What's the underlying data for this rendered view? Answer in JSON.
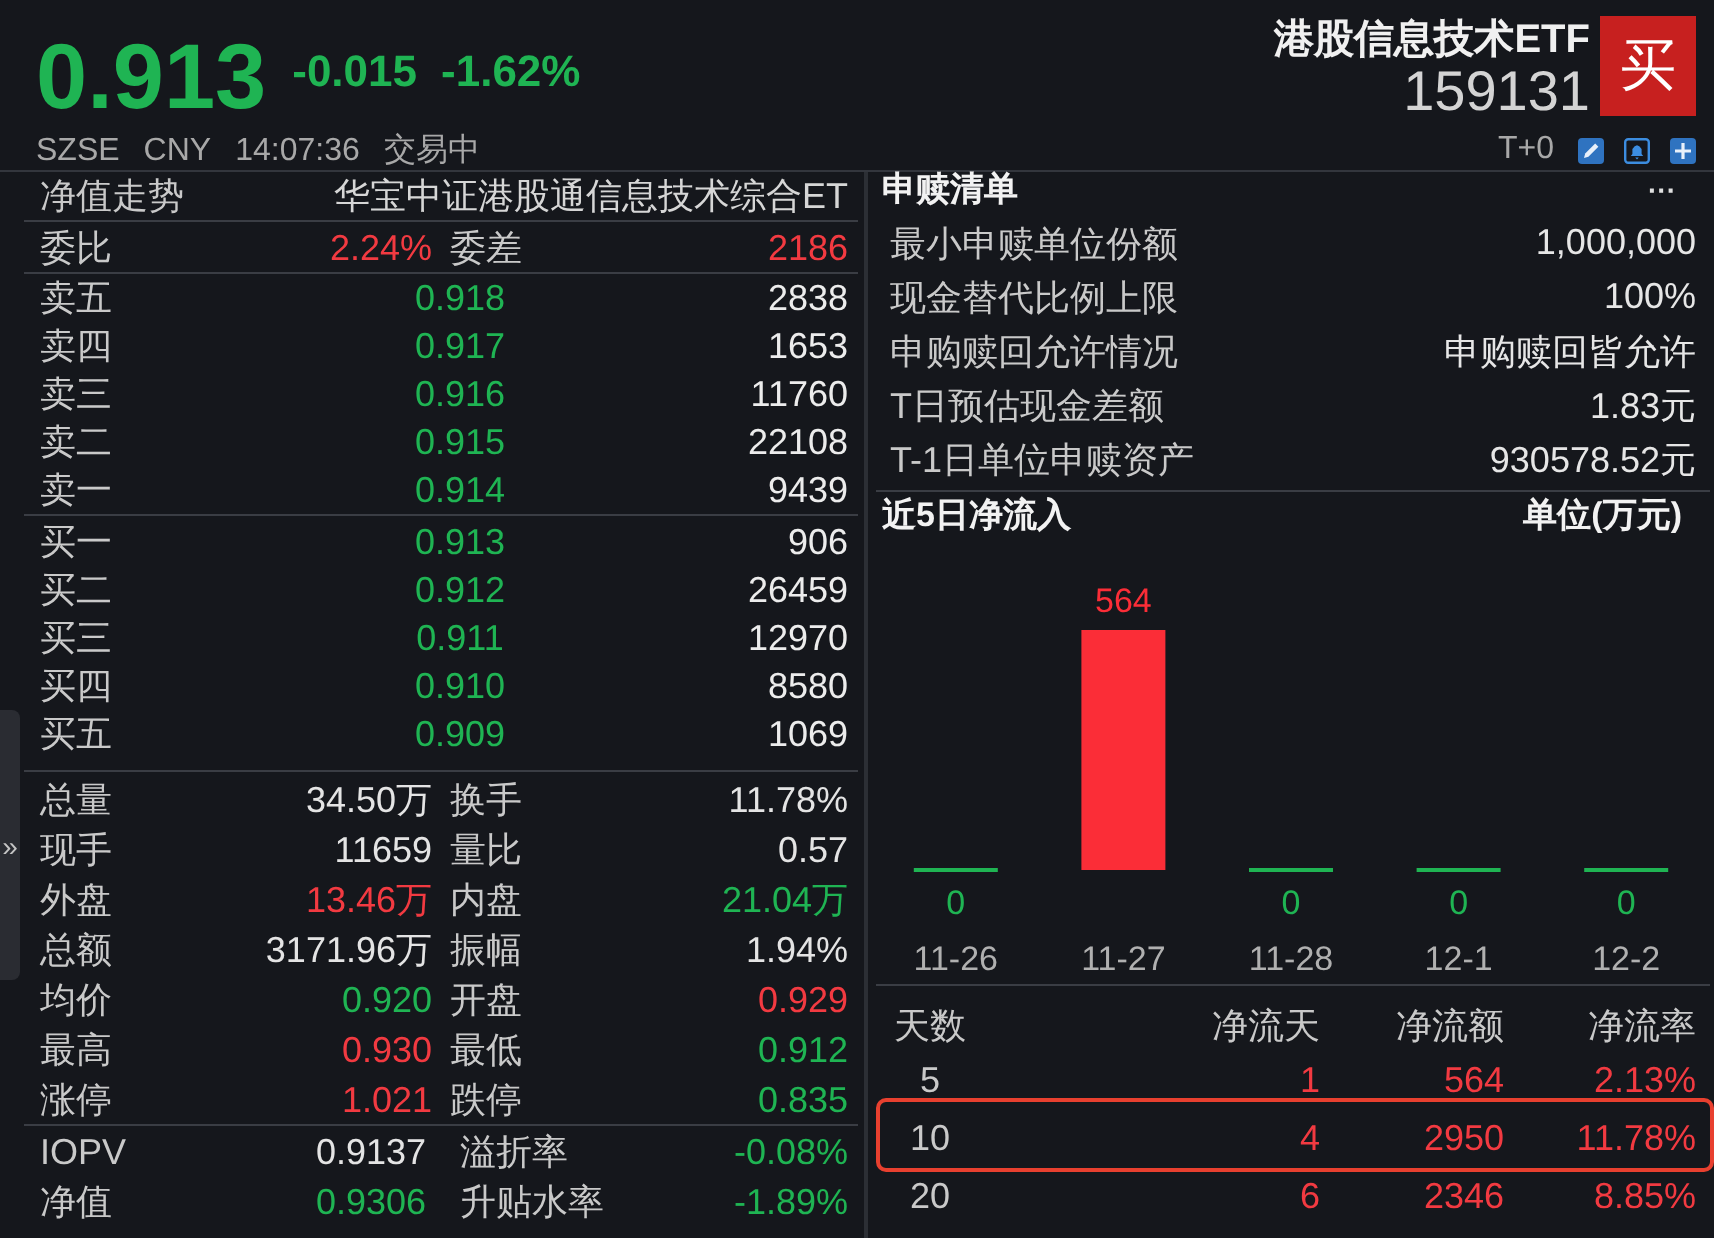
{
  "quote": {
    "price": "0.913",
    "change": "-0.015",
    "change_percent": "-1.62%",
    "color": "#1fb453",
    "name": "港股信息技术ETF",
    "code": "159131",
    "buy_button": "买",
    "exchange": "SZSE",
    "currency": "CNY",
    "time": "14:07:36",
    "status": "交易中",
    "settlement": "T+0"
  },
  "expand_handle": "»",
  "order_panel": {
    "header": {
      "label": "净值走势",
      "fund_name": "华宝中证港股通信息技术综合ET"
    },
    "commission": [
      {
        "label": "委比",
        "value": "2.24%",
        "color": "#f23a41"
      },
      {
        "label": "委差",
        "value": "2186",
        "color": "#f23a41"
      }
    ],
    "asks": [
      {
        "label": "卖五",
        "price": "0.918",
        "volume": "2838",
        "color": "#1fb453"
      },
      {
        "label": "卖四",
        "price": "0.917",
        "volume": "1653",
        "color": "#1fb453"
      },
      {
        "label": "卖三",
        "price": "0.916",
        "volume": "11760",
        "color": "#1fb453"
      },
      {
        "label": "卖二",
        "price": "0.915",
        "volume": "22108",
        "color": "#1fb453"
      },
      {
        "label": "卖一",
        "price": "0.914",
        "volume": "9439",
        "color": "#1fb453"
      }
    ],
    "bids": [
      {
        "label": "买一",
        "price": "0.913",
        "volume": "906",
        "color": "#1fb453"
      },
      {
        "label": "买二",
        "price": "0.912",
        "volume": "26459",
        "color": "#1fb453"
      },
      {
        "label": "买三",
        "price": "0.911",
        "volume": "12970",
        "color": "#1fb453"
      },
      {
        "label": "买四",
        "price": "0.910",
        "volume": "8580",
        "color": "#1fb453"
      },
      {
        "label": "买五",
        "price": "0.909",
        "volume": "1069",
        "color": "#1fb453"
      }
    ],
    "stats": [
      {
        "label": "总量",
        "value": "34.50万",
        "color": "#e4e4e4"
      },
      {
        "label": "换手",
        "value": "11.78%",
        "color": "#e4e4e4"
      },
      {
        "label": "现手",
        "value": "11659",
        "color": "#e4e4e4"
      },
      {
        "label": "量比",
        "value": "0.57",
        "color": "#e4e4e4"
      },
      {
        "label": "外盘",
        "value": "13.46万",
        "color": "#f23a41"
      },
      {
        "label": "内盘",
        "value": "21.04万",
        "color": "#1fb453"
      },
      {
        "label": "总额",
        "value": "3171.96万",
        "color": "#e4e4e4"
      },
      {
        "label": "振幅",
        "value": "1.94%",
        "color": "#e4e4e4"
      },
      {
        "label": "均价",
        "value": "0.920",
        "color": "#1fb453"
      },
      {
        "label": "开盘",
        "value": "0.929",
        "color": "#f23a41"
      },
      {
        "label": "最高",
        "value": "0.930",
        "color": "#f23a41"
      },
      {
        "label": "最低",
        "value": "0.912",
        "color": "#1fb453"
      },
      {
        "label": "涨停",
        "value": "1.021",
        "color": "#f23a41"
      },
      {
        "label": "跌停",
        "value": "0.835",
        "color": "#1fb453"
      }
    ],
    "nav": [
      {
        "label": "IOPV",
        "value": "0.9137",
        "color": "#e4e4e4"
      },
      {
        "label": "溢折率",
        "value": "-0.08%",
        "color": "#1fb453"
      },
      {
        "label": "净值",
        "value": "0.9306",
        "color": "#1fb453"
      },
      {
        "label": "升贴水率",
        "value": "-1.89%",
        "color": "#1fb453"
      }
    ]
  },
  "subscription": {
    "title": "申赎清单",
    "more": "···",
    "items": [
      {
        "label": "最小申赎单位份额",
        "value": "1,000,000"
      },
      {
        "label": "现金替代比例上限",
        "value": "100%"
      },
      {
        "label": "申购赎回允许情况",
        "value": "申购赎回皆允许"
      },
      {
        "label": "T日预估现金差额",
        "value": "1.83元"
      },
      {
        "label": "T-1日单位申赎资产",
        "value": "930578.52元"
      }
    ]
  },
  "fund_flow": {
    "title": "近5日净流入",
    "unit": "单位(万元)",
    "chart_data": {
      "type": "bar",
      "categories": [
        "11-26",
        "11-27",
        "11-28",
        "12-1",
        "12-2"
      ],
      "values": [
        0,
        564,
        0,
        0,
        0
      ],
      "data_labels": true
    }
  },
  "flow_table": {
    "columns": [
      "天数",
      "净流天",
      "净流额",
      "净流率"
    ],
    "rows": [
      {
        "cells": [
          "5",
          "1",
          "564",
          "2.13%"
        ],
        "color": "#f23a41",
        "selected": false
      },
      {
        "cells": [
          "10",
          "4",
          "2950",
          "11.78%"
        ],
        "color": "#f23a41",
        "selected": true
      },
      {
        "cells": [
          "20",
          "6",
          "2346",
          "8.85%"
        ],
        "color": "#f23a41",
        "selected": false
      }
    ]
  }
}
